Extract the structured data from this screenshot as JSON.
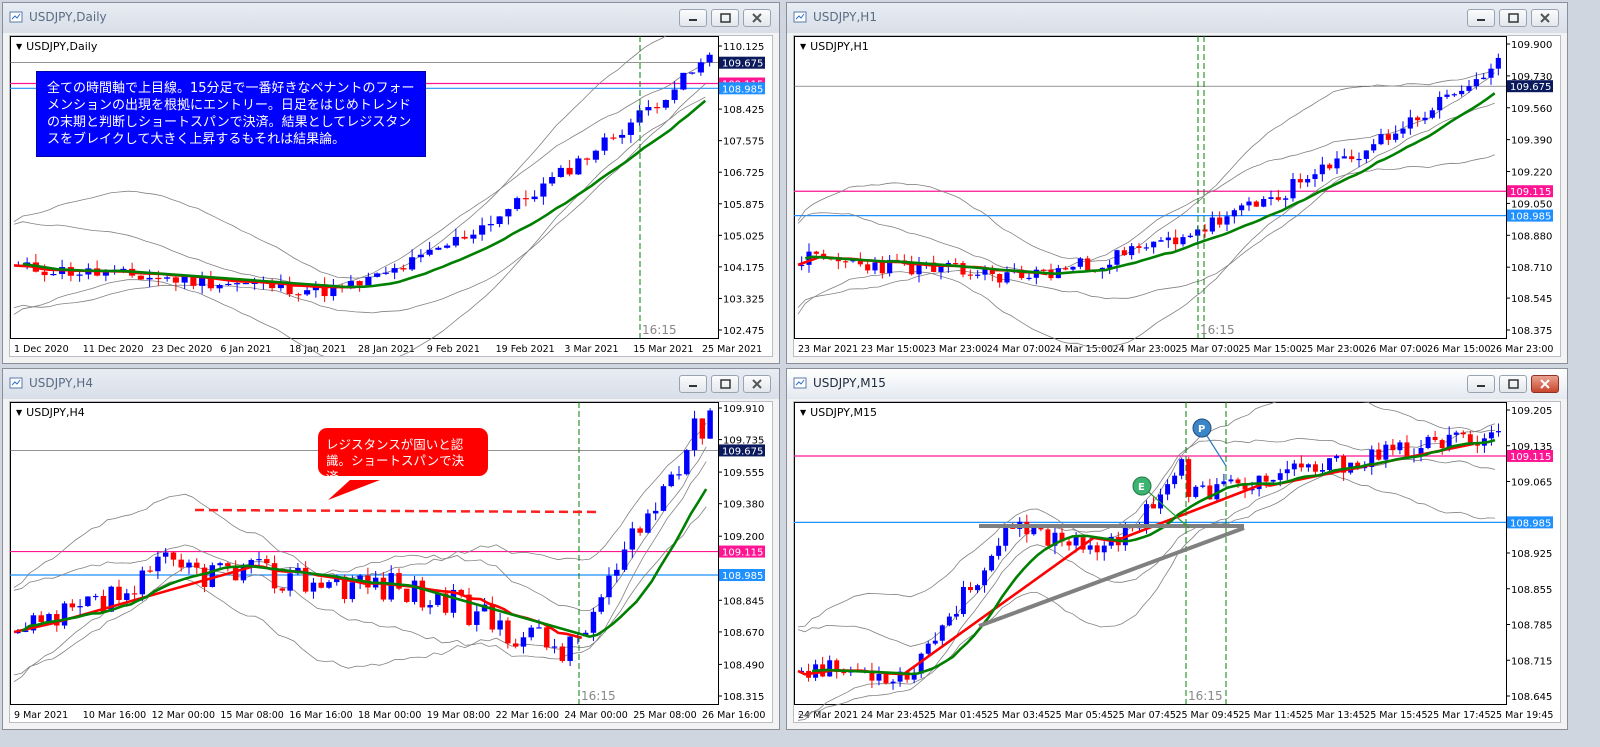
{
  "windows": [
    {
      "id": "daily",
      "title": "USDJPY,Daily",
      "symbol_label": "USDJPY,Daily",
      "active": false,
      "y_ticks": [
        "110.125",
        "109.675",
        "109.115",
        "108.985",
        "108.425",
        "107.575",
        "106.725",
        "105.875",
        "105.025",
        "104.175",
        "103.325",
        "102.475"
      ],
      "x_labels": [
        "1 Dec 2020",
        "11 Dec 2020",
        "23 Dec 2020",
        "6 Jan 2021",
        "18 Jan 2021",
        "28 Jan 2021",
        "9 Feb 2021",
        "19 Feb 2021",
        "3 Mar 2021",
        "15 Mar 2021",
        "25 Mar 2021"
      ],
      "time_label": "16:15",
      "note": "全ての時間軸で上目線。15分足で一番好きなペナントのフォーメンションの出現を根拠にエントリー。日足をはじめトレンドの末期と判断しショートスパンで決済。結果としてレジスタンスをブレイクして大きく上昇するもそれは結果論。"
    },
    {
      "id": "h1",
      "title": "USDJPY,H1",
      "symbol_label": "USDJPY,H1",
      "active": false,
      "y_ticks": [
        "109.900",
        "109.730",
        "109.675",
        "109.560",
        "109.390",
        "109.220",
        "109.115",
        "109.050",
        "108.985",
        "108.880",
        "108.710",
        "108.545",
        "108.375"
      ],
      "x_labels": [
        "23 Mar 2021",
        "23 Mar 15:00",
        "23 Mar 23:00",
        "24 Mar 07:00",
        "24 Mar 15:00",
        "24 Mar 23:00",
        "25 Mar 07:00",
        "25 Mar 15:00",
        "25 Mar 23:00",
        "26 Mar 07:00",
        "26 Mar 15:00",
        "26 Mar 23:00"
      ],
      "time_label": "16:15"
    },
    {
      "id": "h4",
      "title": "USDJPY,H4",
      "symbol_label": "USDJPY,H4",
      "active": false,
      "y_ticks": [
        "109.910",
        "109.735",
        "109.675",
        "109.555",
        "109.380",
        "109.200",
        "109.115",
        "108.985",
        "108.845",
        "108.670",
        "108.490",
        "108.315"
      ],
      "x_labels": [
        "9 Mar 2021",
        "10 Mar 16:00",
        "12 Mar 00:00",
        "15 Mar 08:00",
        "16 Mar 16:00",
        "18 Mar 00:00",
        "19 Mar 08:00",
        "22 Mar 16:00",
        "24 Mar 00:00",
        "25 Mar 08:00",
        "26 Mar 16:00"
      ],
      "time_label": "16:15",
      "note": "レジスタンスが固いと認識。ショートスパンで決済。"
    },
    {
      "id": "m15",
      "title": "USDJPY,M15",
      "symbol_label": "USDJPY,M15",
      "active": true,
      "y_ticks": [
        "109.205",
        "109.135",
        "109.115",
        "109.065",
        "108.985",
        "108.925",
        "108.855",
        "108.785",
        "108.715",
        "108.645"
      ],
      "x_labels": [
        "24 Mar 2021",
        "24 Mar 23:45",
        "25 Mar 01:45",
        "25 Mar 03:45",
        "25 Mar 05:45",
        "25 Mar 07:45",
        "25 Mar 09:45",
        "25 Mar 11:45",
        "25 Mar 13:45",
        "25 Mar 15:45",
        "25 Mar 17:45",
        "25 Mar 19:45"
      ],
      "time_label": "16:15",
      "markers": {
        "entry": "E",
        "exit": "P"
      }
    }
  ],
  "colors": {
    "bull": "#0000ff",
    "bear": "#ff0000",
    "ma_up": "#008000",
    "ma_down": "#ff0000",
    "resistance": "#ff1493",
    "support": "#1e90ff",
    "bands": "#808080",
    "current_price_bg": "#0a1a5c"
  }
}
